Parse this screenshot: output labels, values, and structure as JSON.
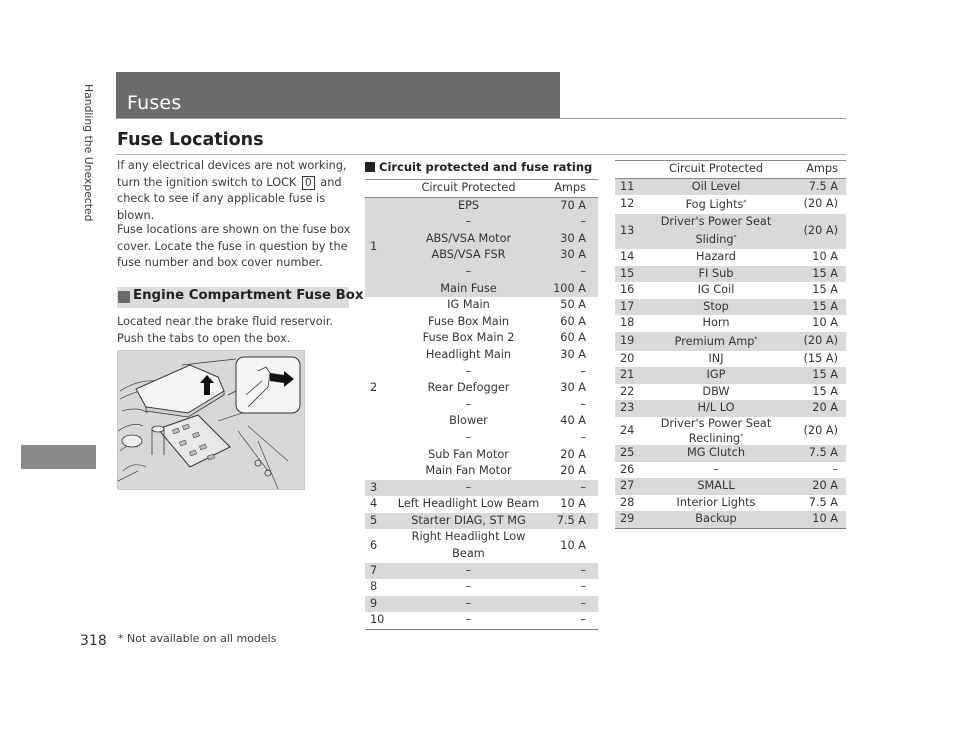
{
  "page": {
    "title": "Fuses",
    "section_title": "Fuse Locations",
    "side_label": "Handling the Unexpected",
    "page_number": "318",
    "footnote": "* Not available on all models"
  },
  "intro": {
    "p1_before": "If any electrical devices are not working, turn the ignition switch to LOCK",
    "lock_key": "0",
    "p1_after": "and check to see if any applicable fuse is blown.",
    "p2": "Fuse locations are shown on the fuse box cover. Locate the fuse in question by the fuse number and box cover number."
  },
  "engine_box": {
    "heading": "Engine Compartment Fuse Box",
    "description": "Located near the brake fluid reservoir. Push the tabs to open the box.",
    "illustration": "engine-compartment-fuse-box-illustration"
  },
  "table1": {
    "heading": "Circuit protected and fuse rating",
    "headers": {
      "circuit": "Circuit Protected",
      "amps": "Amps"
    },
    "groups": [
      {
        "num": "1",
        "shaded": true,
        "rows": [
          {
            "circuit": "EPS",
            "amps": "70 A"
          },
          {
            "circuit": "–",
            "amps": "–"
          },
          {
            "circuit": "ABS/VSA Motor",
            "amps": "30 A"
          },
          {
            "circuit": "ABS/VSA FSR",
            "amps": "30 A"
          },
          {
            "circuit": "–",
            "amps": "–"
          },
          {
            "circuit": "Main Fuse",
            "amps": "100 A"
          }
        ]
      },
      {
        "num": "2",
        "shaded": false,
        "rows": [
          {
            "circuit": "IG Main",
            "amps": "50 A"
          },
          {
            "circuit": "Fuse Box Main",
            "amps": "60 A"
          },
          {
            "circuit": "Fuse Box Main 2",
            "amps": "60 A"
          },
          {
            "circuit": "Headlight Main",
            "amps": "30 A"
          },
          {
            "circuit": "–",
            "amps": "–"
          },
          {
            "circuit": "Rear Defogger",
            "amps": "30 A"
          },
          {
            "circuit": "–",
            "amps": "–"
          },
          {
            "circuit": "Blower",
            "amps": "40 A"
          },
          {
            "circuit": "–",
            "amps": "–"
          },
          {
            "circuit": "Sub Fan Motor",
            "amps": "20 A"
          },
          {
            "circuit": "Main Fan Motor",
            "amps": "20 A"
          }
        ]
      }
    ],
    "rows": [
      {
        "num": "3",
        "circuit": "–",
        "amps": "–"
      },
      {
        "num": "4",
        "circuit": "Left Headlight Low Beam",
        "amps": "10 A"
      },
      {
        "num": "5",
        "circuit": "Starter DIAG, ST MG",
        "amps": "7.5 A"
      },
      {
        "num": "6",
        "circuit": "Right Headlight Low Beam",
        "amps": "10 A"
      },
      {
        "num": "7",
        "circuit": "–",
        "amps": "–"
      },
      {
        "num": "8",
        "circuit": "–",
        "amps": "–"
      },
      {
        "num": "9",
        "circuit": "–",
        "amps": "–"
      },
      {
        "num": "10",
        "circuit": "–",
        "amps": "–"
      }
    ]
  },
  "table2": {
    "headers": {
      "circuit": "Circuit Protected",
      "amps": "Amps"
    },
    "rows": [
      {
        "num": "11",
        "circuit": "Oil Level",
        "amps": "7.5 A"
      },
      {
        "num": "12",
        "circuit": "Fog Lights",
        "note": "*",
        "amps": "(20 A)"
      },
      {
        "num": "13",
        "circuit": "Driver's Power Seat Sliding",
        "note": "*",
        "amps": "(20 A)"
      },
      {
        "num": "14",
        "circuit": "Hazard",
        "amps": "10 A"
      },
      {
        "num": "15",
        "circuit": "FI Sub",
        "amps": "15 A"
      },
      {
        "num": "16",
        "circuit": "IG Coil",
        "amps": "15 A"
      },
      {
        "num": "17",
        "circuit": "Stop",
        "amps": "15 A"
      },
      {
        "num": "18",
        "circuit": "Horn",
        "amps": "10 A"
      },
      {
        "num": "19",
        "circuit": "Premium Amp",
        "note": "*",
        "amps": "(20 A)"
      },
      {
        "num": "20",
        "circuit": "INJ",
        "amps": "(15 A)"
      },
      {
        "num": "21",
        "circuit": "IGP",
        "amps": "15 A"
      },
      {
        "num": "22",
        "circuit": "DBW",
        "amps": "15 A"
      },
      {
        "num": "23",
        "circuit": "H/L LO",
        "amps": "20 A"
      },
      {
        "num": "24",
        "circuit": "Driver's Power Seat",
        "circuit_line2": "Reclining",
        "note": "*",
        "amps": "(20 A)"
      },
      {
        "num": "25",
        "circuit": "MG Clutch",
        "amps": "7.5 A"
      },
      {
        "num": "26",
        "circuit": "–",
        "amps": "–"
      },
      {
        "num": "27",
        "circuit": "SMALL",
        "amps": "20 A"
      },
      {
        "num": "28",
        "circuit": "Interior Lights",
        "amps": "7.5 A"
      },
      {
        "num": "29",
        "circuit": "Backup",
        "amps": "10 A"
      }
    ]
  },
  "colors": {
    "title_bar": "#6b6b6d",
    "row_shade": "#d9d9db",
    "side_tab": "#8a8a8c",
    "subhead_bg": "#dcdcdc"
  }
}
